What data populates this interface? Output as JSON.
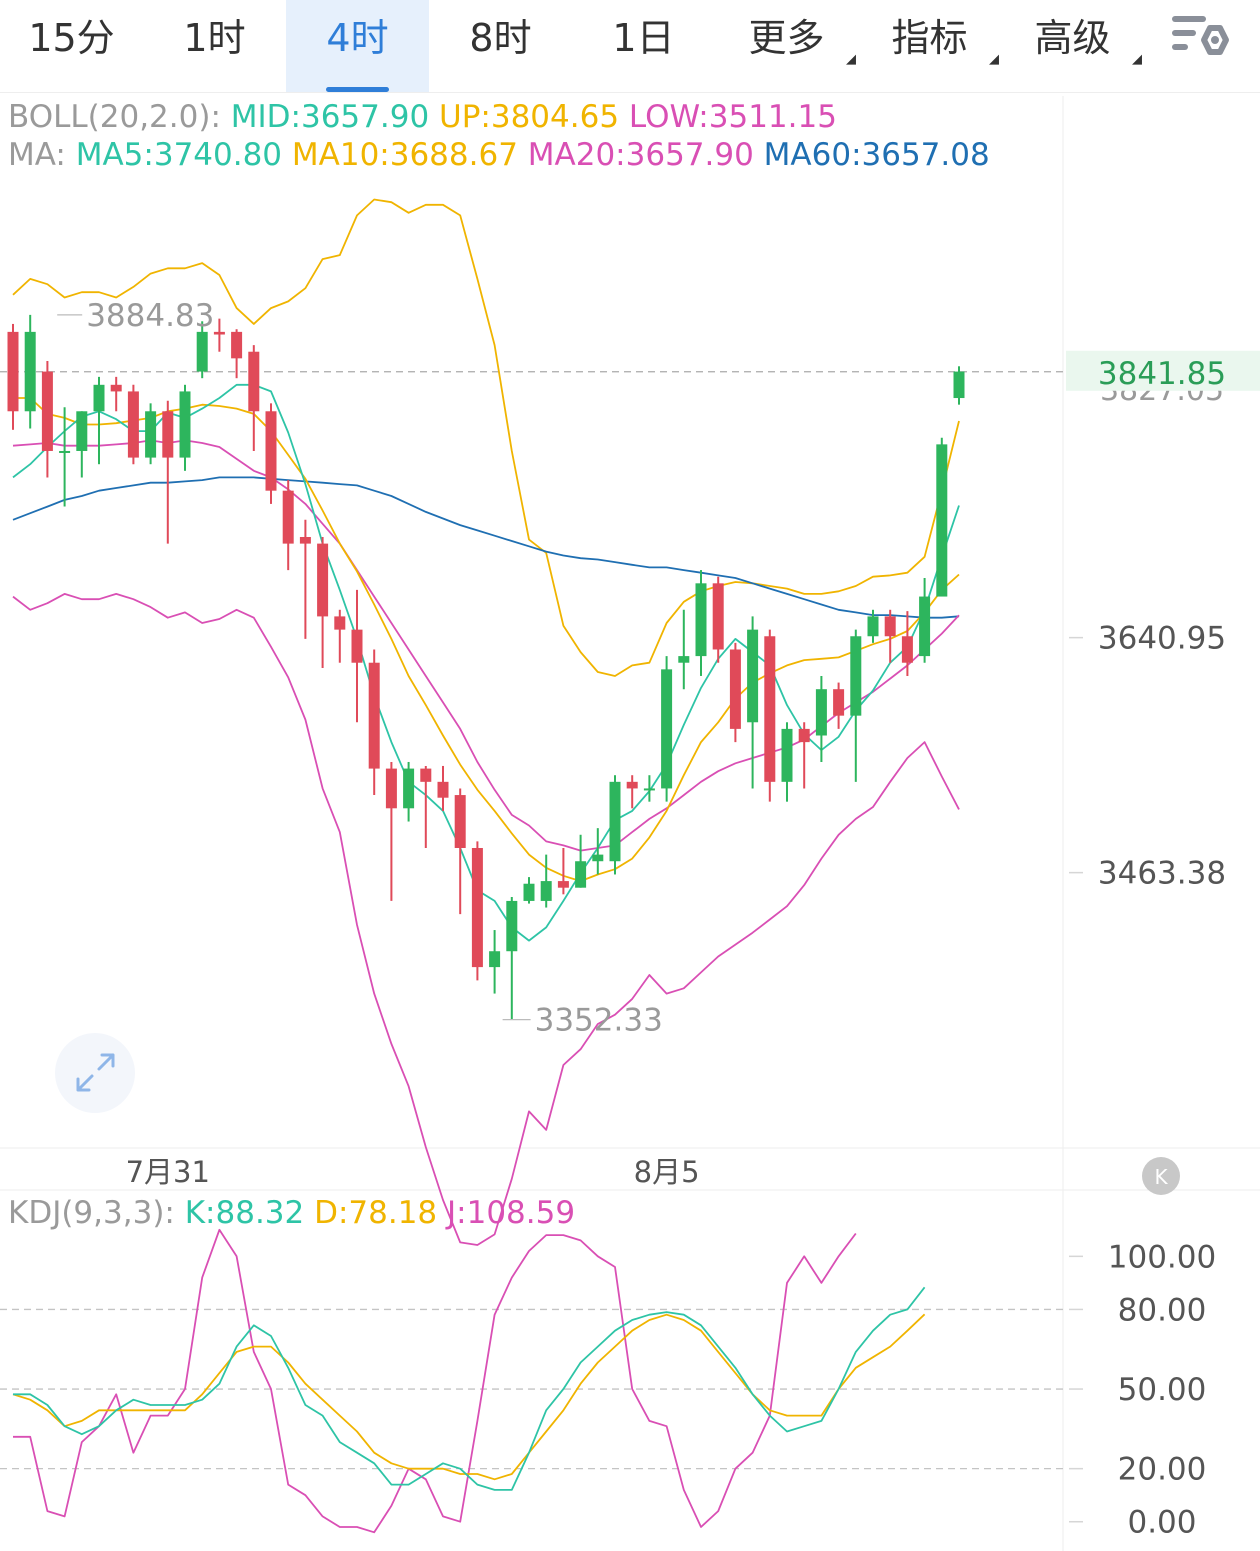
{
  "tabs": [
    {
      "label": "15分",
      "active": false,
      "dropdown": false
    },
    {
      "label": "1时",
      "active": false,
      "dropdown": false
    },
    {
      "label": "4时",
      "active": true,
      "dropdown": false
    },
    {
      "label": "8时",
      "active": false,
      "dropdown": false
    },
    {
      "label": "1日",
      "active": false,
      "dropdown": false
    },
    {
      "label": "更多",
      "active": false,
      "dropdown": true
    },
    {
      "label": "指标",
      "active": false,
      "dropdown": true
    },
    {
      "label": "高级",
      "active": false,
      "dropdown": true
    }
  ],
  "toolbar_icon": "chart-settings-icon",
  "expand_icon": "expand-icon",
  "k_badge": "K",
  "colors": {
    "up": "#2db55d",
    "down": "#e04a59",
    "mid": "#2ec4a6",
    "upper_band": "#f0b400",
    "lower_band": "#d94fb4",
    "ma60": "#1f6fb2",
    "grey": "#9a9a9a",
    "accent": "#2f7ed8",
    "price_tag": "#2a9d57"
  },
  "chart_data": [
    {
      "type": "candlestick",
      "legend_boll": {
        "prefix": "BOLL(20,2.0):",
        "items": [
          {
            "text": "MID:3657.90",
            "color": "#2ec4a6"
          },
          {
            "text": "UP:3804.65",
            "color": "#f0b400"
          },
          {
            "text": "LOW:3511.15",
            "color": "#d94fb4"
          }
        ]
      },
      "legend_ma": {
        "prefix": "MA:",
        "items": [
          {
            "text": "MA5:3740.80",
            "color": "#2ec4a6"
          },
          {
            "text": "MA10:3688.67",
            "color": "#f0b400"
          },
          {
            "text": "MA20:3657.90",
            "color": "#d94fb4"
          },
          {
            "text": "MA60:3657.08",
            "color": "#1f6fb2"
          }
        ]
      },
      "ylim": [
        3281,
        3952
      ],
      "y_ticks": [
        "3640.95",
        "3463.38"
      ],
      "y_tick_values": [
        3640.95,
        3463.38
      ],
      "x_labels": [
        {
          "label": "7月31",
          "index": 9
        },
        {
          "label": "8月5",
          "index": 38
        }
      ],
      "current_price": {
        "label": "3841.85",
        "value": 3841.85
      },
      "ghost_label": "3827.05",
      "max_marker": {
        "label": "3884.83",
        "value": 3884.83,
        "index": 1
      },
      "min_marker": {
        "label": "3352.33",
        "value": 3352.33,
        "index": 28
      },
      "candles": [
        [
          3872,
          3812,
          3878,
          3798
        ],
        [
          3812,
          3872,
          3884.83,
          3799
        ],
        [
          3842,
          3782,
          3850,
          3762
        ],
        [
          3782,
          3782,
          3815,
          3740
        ],
        [
          3782,
          3812,
          3812,
          3762
        ],
        [
          3812,
          3832,
          3838,
          3772
        ],
        [
          3832,
          3827,
          3838,
          3812
        ],
        [
          3827,
          3777,
          3832,
          3772
        ],
        [
          3777,
          3812,
          3818,
          3772
        ],
        [
          3812,
          3777,
          3820,
          3712
        ],
        [
          3777,
          3827,
          3832,
          3767
        ],
        [
          3842,
          3872,
          3880,
          3837
        ],
        [
          3872,
          3870,
          3882,
          3857
        ],
        [
          3872,
          3852,
          3874,
          3837
        ],
        [
          3857,
          3812,
          3862,
          3782
        ],
        [
          3812,
          3752,
          3818,
          3742
        ],
        [
          3752,
          3712,
          3760,
          3692
        ],
        [
          3717,
          3712,
          3730,
          3640
        ],
        [
          3712,
          3657,
          3717,
          3618
        ],
        [
          3657,
          3647,
          3662,
          3622
        ],
        [
          3647,
          3622,
          3677,
          3577
        ],
        [
          3622,
          3542,
          3632,
          3522
        ],
        [
          3542,
          3512,
          3547,
          3442
        ],
        [
          3512,
          3542,
          3547,
          3502
        ],
        [
          3542,
          3532,
          3544,
          3482
        ],
        [
          3532,
          3520,
          3544,
          3510
        ],
        [
          3522,
          3482,
          3527,
          3432
        ],
        [
          3482,
          3392,
          3487,
          3382
        ],
        [
          3392,
          3404,
          3420,
          3372
        ],
        [
          3404,
          3442,
          3445,
          3352.33
        ],
        [
          3442,
          3455,
          3460,
          3440
        ],
        [
          3442,
          3457,
          3477,
          3437
        ],
        [
          3457,
          3452,
          3482,
          3447
        ],
        [
          3452,
          3472,
          3492,
          3452
        ],
        [
          3472,
          3477,
          3497,
          3462
        ],
        [
          3472,
          3532,
          3537,
          3462
        ],
        [
          3532,
          3527,
          3537,
          3512
        ],
        [
          3527,
          3527,
          3537,
          3517
        ],
        [
          3527,
          3617,
          3627,
          3517
        ],
        [
          3622,
          3627,
          3662,
          3602
        ],
        [
          3627,
          3682,
          3692,
          3612
        ],
        [
          3682,
          3632,
          3687,
          3622
        ],
        [
          3632,
          3572,
          3637,
          3562
        ],
        [
          3577,
          3647,
          3657,
          3527
        ],
        [
          3642,
          3532,
          3647,
          3517
        ],
        [
          3532,
          3572,
          3577,
          3517
        ],
        [
          3572,
          3562,
          3577,
          3527
        ],
        [
          3567,
          3602,
          3612,
          3547
        ],
        [
          3602,
          3582,
          3607,
          3572
        ],
        [
          3582,
          3642,
          3647,
          3532
        ],
        [
          3642,
          3657,
          3662,
          3637
        ],
        [
          3657,
          3642,
          3662,
          3622
        ],
        [
          3642,
          3622,
          3661,
          3612
        ],
        [
          3627,
          3672,
          3686,
          3622
        ],
        [
          3672,
          3787,
          3792,
          3672
        ],
        [
          3822,
          3842,
          3846,
          3817
        ]
      ],
      "boll_upper": [
        3900,
        3912,
        3908,
        3898,
        3902,
        3902,
        3898,
        3906,
        3916,
        3920,
        3920,
        3924,
        3915,
        3890,
        3878,
        3890,
        3895,
        3905,
        3927,
        3930,
        3960,
        3972,
        3970,
        3962,
        3968,
        3968,
        3960,
        3912,
        3862,
        3782,
        3715,
        3705,
        3650,
        3630,
        3615,
        3612,
        3620,
        3622,
        3652,
        3668,
        3676,
        3680,
        3683,
        3682,
        3680,
        3678,
        3674,
        3674,
        3676,
        3680,
        3687,
        3688,
        3690,
        3702,
        3752,
        3804.65
      ],
      "boll_mid": [
        3786,
        3787,
        3788,
        3786,
        3786,
        3786,
        3787,
        3788,
        3790,
        3788,
        3790,
        3788,
        3785,
        3776,
        3767,
        3762,
        3753,
        3742,
        3727,
        3712,
        3692,
        3672,
        3652,
        3632,
        3612,
        3592,
        3572,
        3547,
        3526,
        3507,
        3499,
        3487,
        3484,
        3480,
        3482,
        3484,
        3494,
        3504,
        3512,
        3522,
        3532,
        3540,
        3546,
        3550,
        3554,
        3558,
        3564,
        3574,
        3584,
        3592,
        3600,
        3610,
        3620,
        3632,
        3644,
        3657.9
      ],
      "boll_lower": [
        3672,
        3662,
        3667,
        3674,
        3670,
        3670,
        3674,
        3670,
        3664,
        3656,
        3660,
        3652,
        3655,
        3662,
        3656,
        3634,
        3611,
        3579,
        3527,
        3494,
        3424,
        3372,
        3334,
        3302,
        3256,
        3216,
        3184,
        3182,
        3190,
        3232,
        3283,
        3269,
        3318,
        3330,
        3349,
        3356,
        3368,
        3386,
        3372,
        3376,
        3388,
        3400,
        3409,
        3418,
        3428,
        3438,
        3454,
        3474,
        3492,
        3504,
        3513,
        3532,
        3550,
        3562,
        3536,
        3511.15
      ],
      "ma5": [
        3762,
        3772,
        3785,
        3797,
        3808,
        3812,
        3806,
        3797,
        3797,
        3811,
        3807,
        3814,
        3822,
        3832,
        3832,
        3827,
        3796,
        3757,
        3712,
        3677,
        3640,
        3597,
        3562,
        3532,
        3522,
        3510,
        3482,
        3450,
        3442,
        3422,
        3412,
        3422,
        3442,
        3463,
        3482,
        3503,
        3510,
        3525,
        3545,
        3575,
        3603,
        3625,
        3640,
        3630,
        3620,
        3590,
        3568,
        3556,
        3566,
        3586,
        3601,
        3622,
        3634,
        3662,
        3702,
        3740.8
      ],
      "ma10": [
        3822,
        3822,
        3810,
        3807,
        3802,
        3802,
        3803,
        3805,
        3807,
        3812,
        3814,
        3817,
        3816,
        3814,
        3810,
        3797,
        3779,
        3761,
        3737,
        3712,
        3691,
        3666,
        3640,
        3612,
        3590,
        3567,
        3545,
        3526,
        3510,
        3493,
        3477,
        3467,
        3461,
        3457,
        3462,
        3466,
        3474,
        3490,
        3510,
        3537,
        3562,
        3577,
        3595,
        3607,
        3614,
        3620,
        3624,
        3625,
        3626,
        3631,
        3636,
        3640,
        3646,
        3660,
        3677,
        3688.67
      ],
      "ma60": [
        3730,
        3735,
        3740,
        3745,
        3748,
        3752,
        3754,
        3756,
        3758,
        3758,
        3759,
        3760,
        3762,
        3762,
        3762,
        3761,
        3760,
        3759,
        3758,
        3757,
        3756,
        3752,
        3748,
        3742,
        3736,
        3731,
        3726,
        3722,
        3718,
        3714,
        3710,
        3706,
        3703,
        3701,
        3700,
        3698,
        3696,
        3694,
        3694,
        3692,
        3690,
        3688,
        3686,
        3682,
        3678,
        3674,
        3670,
        3666,
        3662,
        3660,
        3658,
        3658,
        3657,
        3656,
        3656,
        3657.08
      ]
    },
    {
      "type": "line",
      "legend": {
        "prefix": "KDJ(9,3,3):",
        "items": [
          {
            "text": "K:88.32",
            "color": "#2ec4a6"
          },
          {
            "text": "D:78.18",
            "color": "#f0b400"
          },
          {
            "text": "J:108.59",
            "color": "#d94fb4"
          }
        ]
      },
      "ylim": [
        -5,
        125
      ],
      "y_ticks": [
        "100.00",
        "80.00",
        "50.00",
        "20.00",
        "0.00"
      ],
      "y_tick_values": [
        100,
        80,
        50,
        20,
        0
      ],
      "k": [
        48,
        48,
        44,
        36,
        33,
        36,
        42,
        46,
        44,
        44,
        44,
        46,
        52,
        66,
        74,
        70,
        58,
        44,
        40,
        30,
        26,
        22,
        14,
        14,
        18,
        22,
        20,
        14,
        12,
        12,
        26,
        42,
        50,
        60,
        66,
        72,
        76,
        78,
        79,
        78,
        74,
        66,
        58,
        48,
        40,
        34,
        36,
        38,
        50,
        64,
        72,
        78,
        80,
        88.32
      ],
      "d": [
        48,
        46,
        42,
        36,
        38,
        42,
        42,
        42,
        42,
        42,
        42,
        48,
        56,
        64,
        66,
        66,
        60,
        52,
        46,
        40,
        34,
        26,
        22,
        20,
        20,
        20,
        18,
        18,
        16,
        18,
        26,
        34,
        42,
        52,
        60,
        66,
        72,
        76,
        78,
        76,
        72,
        64,
        56,
        48,
        42,
        40,
        40,
        40,
        50,
        58,
        62,
        66,
        72,
        78.18
      ],
      "j": [
        32,
        32,
        4,
        2,
        30,
        36,
        48,
        26,
        40,
        40,
        50,
        92,
        110,
        100,
        64,
        50,
        14,
        10,
        2,
        -2,
        -2,
        -4,
        6,
        20,
        16,
        2,
        0,
        38,
        78,
        92,
        102,
        108,
        108,
        106,
        100,
        96,
        50,
        38,
        36,
        12,
        -2,
        4,
        20,
        26,
        40,
        90,
        100,
        90,
        100,
        108.59
      ]
    }
  ]
}
